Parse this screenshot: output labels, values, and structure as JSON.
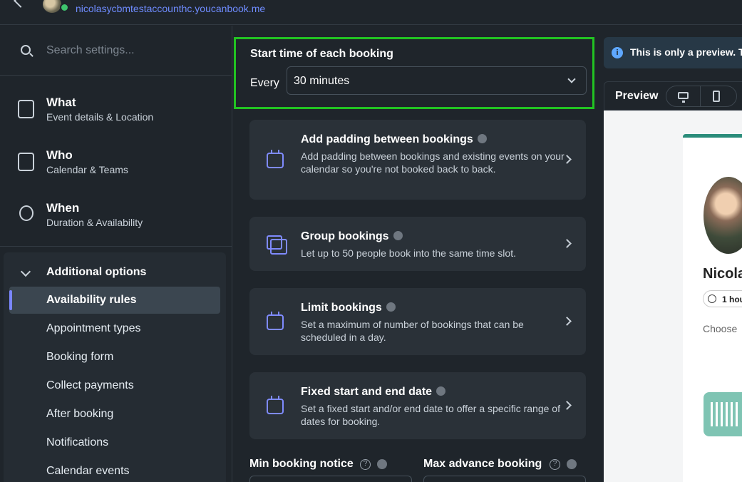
{
  "header": {
    "account_url": "nicolasycbmtestaccounthc.youcanbook.me"
  },
  "sidebar": {
    "search_placeholder": "Search settings...",
    "nav": [
      {
        "title": "What",
        "subtitle": "Event details & Location",
        "icon": "document-icon"
      },
      {
        "title": "Who",
        "subtitle": "Calendar & Teams",
        "icon": "contact-calendar-icon"
      },
      {
        "title": "When",
        "subtitle": "Duration & Availability",
        "icon": "watch-icon"
      }
    ],
    "additional_options": {
      "label": "Additional options",
      "items": [
        {
          "label": "Availability rules",
          "active": true
        },
        {
          "label": "Appointment types",
          "active": false
        },
        {
          "label": "Booking form",
          "active": false
        },
        {
          "label": "Collect payments",
          "active": false
        },
        {
          "label": "After booking",
          "active": false
        },
        {
          "label": "Notifications",
          "active": false
        },
        {
          "label": "Calendar events",
          "active": false
        }
      ]
    }
  },
  "start_time": {
    "title": "Start time of each booking",
    "every_label": "Every",
    "selected": "30 minutes"
  },
  "cards": [
    {
      "title": "Add padding between bookings",
      "desc": "Add padding between bookings and existing events on your calendar so you're not booked back to back.",
      "icon": "padding-calendar-icon"
    },
    {
      "title": "Group bookings",
      "desc": "Let up to 50 people book into the same time slot.",
      "icon": "stacked-calendars-icon"
    },
    {
      "title": "Limit bookings",
      "desc": "Set a maximum of number of bookings that can be scheduled in a day.",
      "icon": "limit-calendar-icon"
    },
    {
      "title": "Fixed start and end date",
      "desc": "Set a fixed start and/or end date to offer a specific range of dates for booking.",
      "icon": "date-range-calendar-icon"
    }
  ],
  "bottom": {
    "min_notice_label": "Min booking notice",
    "max_advance_label": "Max advance booking"
  },
  "preview": {
    "notice": "This is only a preview. T",
    "label": "Preview",
    "booking_name": "Nicola",
    "duration": "1 hou",
    "choose": "Choose"
  },
  "colors": {
    "background": "#1f252b",
    "card": "#2a3138",
    "highlight_border": "#22c322",
    "accent": "#7a86ff",
    "link": "#6f8cff"
  }
}
